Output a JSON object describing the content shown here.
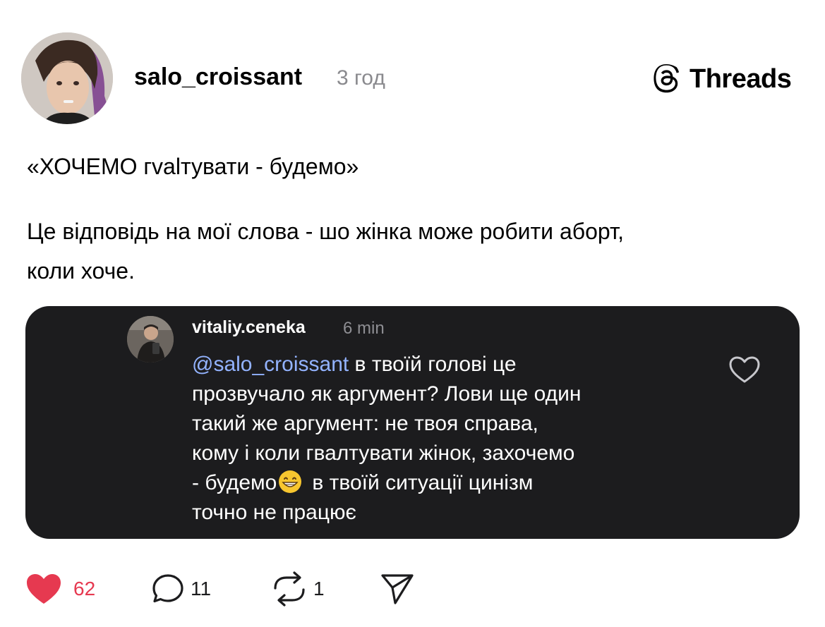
{
  "post": {
    "author": "salo_croissant",
    "time": "3 год",
    "brand": "Threads",
    "title": "«ХОЧЕМО гvalтувати - будемо»",
    "body_lines": [
      "Це відповідь на мої слова - шо жінка може робити аборт,",
      "коли хоче."
    ]
  },
  "embedded_comment": {
    "author": "vitaliy.ceneka",
    "time": "6 min",
    "mention": "@salo_croissant",
    "line1_rest": " в твоїй голові це",
    "lines": [
      "прозвучало як аргумент? Лови ще один",
      "такий же аргумент: не твоя справа,",
      "кому і коли гвалтувати жінок, захочемо"
    ],
    "line5_before_emoji": "- будемо",
    "line5_after_emoji": "в твоїй ситуації цинізм",
    "line6": "точно не працює"
  },
  "actions": {
    "likes": "62",
    "replies": "11",
    "reposts": "1"
  },
  "colors": {
    "like": "#e63950",
    "mention": "#93b3ff",
    "embed_background": "#1c1c1e",
    "muted_text": "#8a8a8e"
  },
  "icons": [
    "threads-logo-icon",
    "heart-outline-icon",
    "heart-filled-icon",
    "comment-icon",
    "repost-icon",
    "share-icon",
    "grinning-emoji-icon"
  ]
}
